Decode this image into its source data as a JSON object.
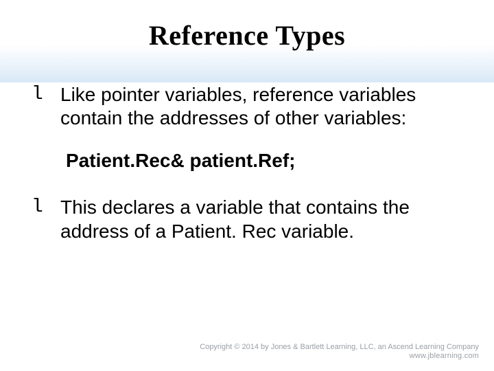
{
  "title": "Reference Types",
  "bullets": [
    "Like pointer variables, reference variables contain the addresses of other variables:",
    "This declares a variable that contains the address of a Patient. Rec variable."
  ],
  "code_line": "Patient.Rec& patient.Ref;",
  "bullet_marker": "l",
  "footer": {
    "copyright": "Copyright © 2014 by Jones & Bartlett Learning, LLC, an Ascend Learning Company",
    "url": "www.jblearning.com"
  }
}
